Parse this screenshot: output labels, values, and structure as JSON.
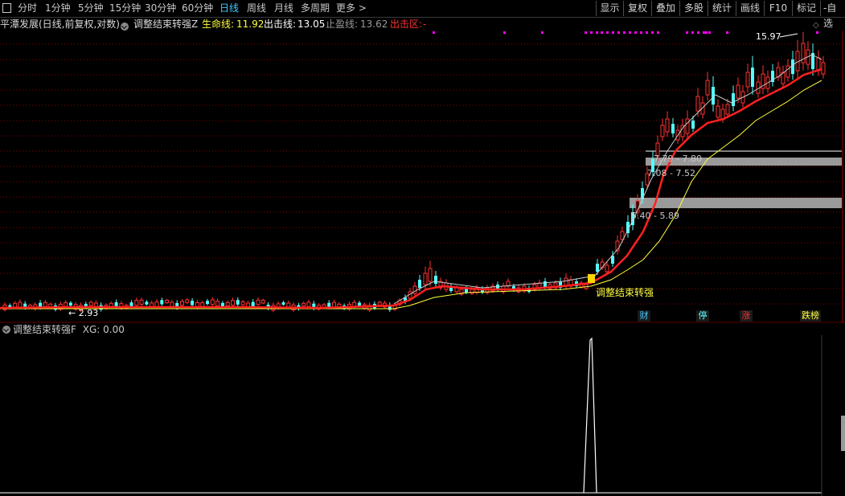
{
  "toolbar": {
    "periods": [
      "分时",
      "1分钟",
      "5分钟",
      "15分钟",
      "30分钟",
      "60分钟",
      "日线",
      "周线",
      "月线",
      "多周期",
      "更多"
    ],
    "active_period": "日线",
    "more_arrow": ">",
    "right_buttons": [
      "显示",
      "复权",
      "叠加",
      "多股",
      "统计",
      "画线",
      "F10",
      "标记",
      "-自选"
    ]
  },
  "info": {
    "stock": "平潭发展(日线,前复权,对数)",
    "indicator": "调整结束转强Z",
    "life_label": "生命线:",
    "life_value": "11.92",
    "exit_label": "出击线:",
    "exit_value": "13.05",
    "stop_label": "止盈线:",
    "stop_value": "13.62",
    "zone_label": "出击区:",
    "zone_value": "-"
  },
  "annotations": {
    "high": "15.97",
    "low": "2.93",
    "signal": "调整结束转强",
    "gap1": "7.79 - 7.80",
    "gap2": "7.08 - 7.52",
    "gap3": "5.40 - 5.89"
  },
  "badges": [
    "财",
    "停",
    "涨",
    "跌榜"
  ],
  "lower": {
    "title": "调整结束转强F",
    "xg_label": "XG:",
    "xg_value": "0.00"
  },
  "colors": {
    "up": "#ff3232",
    "down": "#54ffff",
    "ma_red": "#ff2020",
    "ma_yellow": "#ffff40",
    "ma_white": "#c8c8c8",
    "grid": "#8b0000",
    "signal_box": "#ffd700",
    "magenta": "#ff00ff"
  },
  "icons": [
    "window-square-icon",
    "dropdown-circle-icon",
    "diamond-icon"
  ]
}
